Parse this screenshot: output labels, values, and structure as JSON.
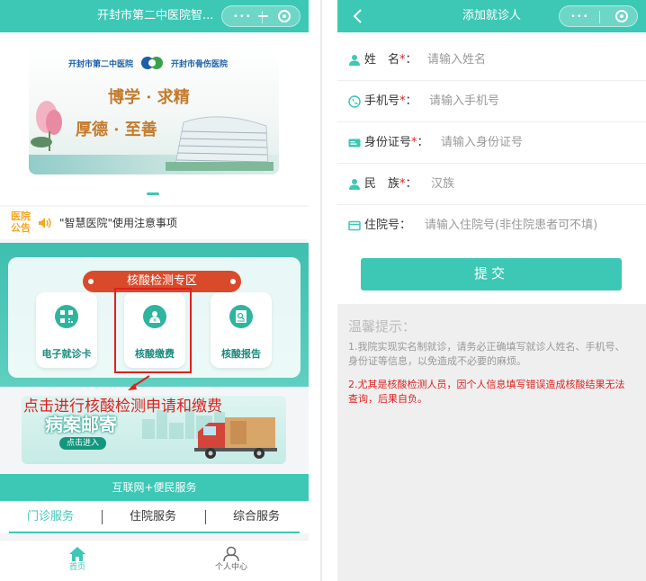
{
  "left": {
    "nav": {
      "title": "开封市第二中医院智..."
    },
    "banner": {
      "logo_left": "开封市第二中医院",
      "logo_right": "开封市骨伤医院",
      "slogan_line1": "博学 · 求精",
      "slogan_line2": "厚德 · 至善"
    },
    "notice": {
      "tag": "医院公告",
      "text": "\"智慧医院\"使用注意事项"
    },
    "covid": {
      "title": "核酸检测专区",
      "tiles": [
        {
          "label": "电子就诊卡",
          "icon": "qr-card-icon"
        },
        {
          "label": "核酸缴费",
          "icon": "payment-icon"
        },
        {
          "label": "核酸报告",
          "icon": "report-icon"
        }
      ]
    },
    "annotation": "点击进行核酸检测申请和缴费",
    "mail_banner": {
      "title": "病案邮寄",
      "enter": "点击进入"
    },
    "services": {
      "header": "互联网+便民服务",
      "tabs": [
        "门诊服务",
        "住院服务",
        "综合服务"
      ],
      "active_tab": 0
    },
    "tabbar": [
      {
        "label": "首页",
        "icon": "home-icon"
      },
      {
        "label": "个人中心",
        "icon": "user-icon"
      }
    ],
    "colors": {
      "accent": "#3cc8b5",
      "warning": "#e02020",
      "notice_tag": "#f5a623"
    }
  },
  "right": {
    "nav": {
      "title": "添加就诊人"
    },
    "form": [
      {
        "label": "姓　名",
        "required": true,
        "placeholder": "请输入姓名",
        "icon": "person-icon"
      },
      {
        "label": "手机号",
        "required": true,
        "placeholder": "请输入手机号",
        "icon": "phone-icon"
      },
      {
        "label": "身份证号",
        "required": true,
        "placeholder": "请输入身份证号",
        "icon": "id-card-icon"
      },
      {
        "label": "民　族",
        "required": true,
        "value": "汉族",
        "icon": "person-icon"
      },
      {
        "label": "住院号",
        "required": false,
        "placeholder": "请输入住院号(非住院患者可不填)",
        "icon": "card-icon"
      }
    ],
    "submit_label": "提交",
    "tips": {
      "heading": "温馨提示：",
      "line1": "1.我院实现实名制就诊，请务必正确填写就诊人姓名、手机号、身份证等信息，以免造成不必要的麻烦。",
      "line2": "2.尤其是核酸检测人员，因个人信息填写错误造成核酸结果无法查询，后果自负。"
    }
  }
}
